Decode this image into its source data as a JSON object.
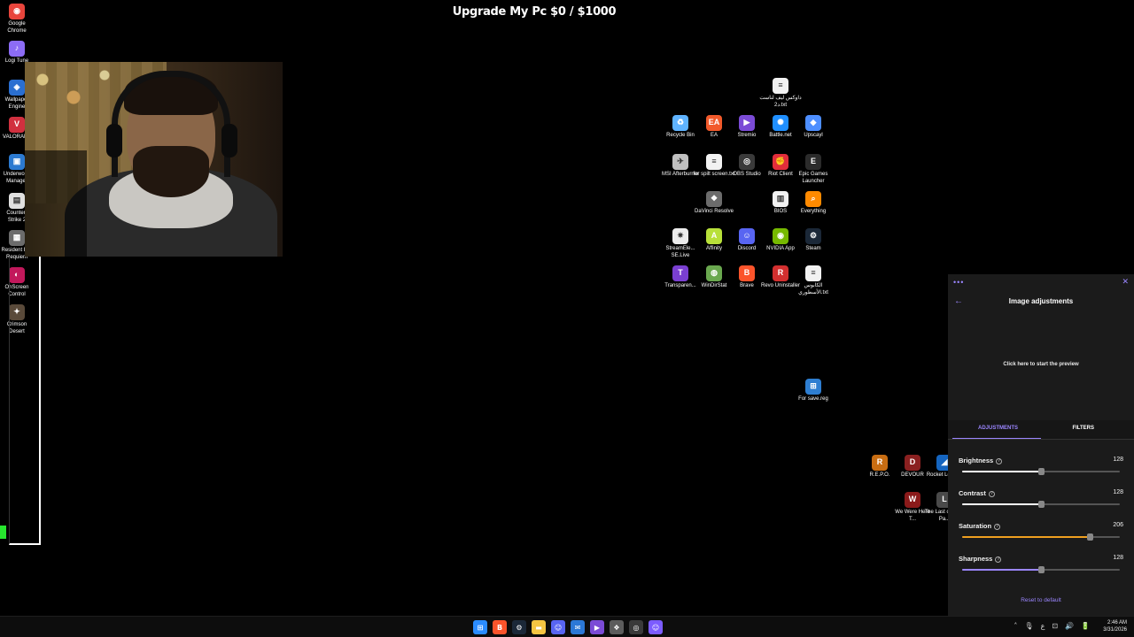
{
  "stream_title": "Upgrade My Pc $0 / $1000",
  "left_icons": [
    {
      "label": "Google Chrome",
      "icon": "chrome-icon",
      "color": "#e8453c",
      "glyph": "◉"
    },
    {
      "label": "Logi Tune",
      "icon": "logi-tune-icon",
      "color": "#8c6cf5",
      "glyph": "♪"
    },
    {
      "label": "Wallpaper Engine",
      "icon": "wallpaper-engine-icon",
      "color": "#2a6fd1",
      "glyph": "◈"
    },
    {
      "label": "VALORANT",
      "icon": "valorant-icon",
      "color": "#d1303f",
      "glyph": "V"
    },
    {
      "label": "Underworld Manager",
      "icon": "game-icon",
      "color": "#2c7ad0",
      "glyph": "▣"
    },
    {
      "label": "Counter-Strike 2",
      "icon": "cs2-icon",
      "color": "#e0e0e0",
      "glyph": "▤"
    },
    {
      "label": "Resident Evil Requiem",
      "icon": "resident-evil-icon",
      "color": "#6c6c6c",
      "glyph": "▦"
    },
    {
      "label": "OnScreen Control",
      "icon": "onscreen-control-icon",
      "color": "#c2185b",
      "glyph": "◐"
    },
    {
      "label": "Crimson Desert",
      "icon": "crimson-desert-icon",
      "color": "#5a4a3a",
      "glyph": "✦"
    }
  ],
  "desktop_icons": [
    {
      "label": "داوكس ليف لناست د2.txt",
      "icon": "text-file-icon",
      "color": "#f2f2f2",
      "glyph": "≡"
    },
    {
      "label": "Recycle Bin",
      "icon": "recycle-bin-icon",
      "color": "#5fb3ff",
      "glyph": "♻"
    },
    {
      "label": "EA",
      "icon": "ea-icon",
      "color": "#f25a2b",
      "glyph": "EA"
    },
    {
      "label": "Stremio",
      "icon": "stremio-icon",
      "color": "#7b4bd6",
      "glyph": "▶"
    },
    {
      "label": "Battle.net",
      "icon": "battlenet-icon",
      "color": "#1f8fff",
      "glyph": "✺"
    },
    {
      "label": "Upscayl",
      "icon": "upscayl-icon",
      "color": "#4d8eff",
      "glyph": "◆"
    },
    {
      "label": "MSI Afterburner",
      "icon": "msi-afterburner-icon",
      "color": "#c0c0c0",
      "glyph": "✈"
    },
    {
      "label": "for spilt screen.txt",
      "icon": "text-file-icon",
      "color": "#f2f2f2",
      "glyph": "≡"
    },
    {
      "label": "OBS Studio",
      "icon": "obs-icon",
      "color": "#3a3a3a",
      "glyph": "◎"
    },
    {
      "label": "Riot Client",
      "icon": "riot-client-icon",
      "color": "#e22d3b",
      "glyph": "✊"
    },
    {
      "label": "Epic Games Launcher",
      "icon": "epic-games-icon",
      "color": "#2b2b2b",
      "glyph": "E"
    },
    {
      "label": "DaVinci Resolve",
      "icon": "davinci-icon",
      "color": "#6c6c6c",
      "glyph": "❖"
    },
    {
      "label": "BIOS",
      "icon": "bios-icon",
      "color": "#f2f2f2",
      "glyph": "▥"
    },
    {
      "label": "Everything",
      "icon": "everything-icon",
      "color": "#ff8a00",
      "glyph": "⌕"
    },
    {
      "label": "StreamEle... SE.Live",
      "icon": "streamelements-icon",
      "color": "#ececec",
      "glyph": "✷"
    },
    {
      "label": "Affinity",
      "icon": "affinity-icon",
      "color": "#b8e03a",
      "glyph": "A"
    },
    {
      "label": "Discord",
      "icon": "discord-icon",
      "color": "#5865f2",
      "glyph": "☺"
    },
    {
      "label": "NVIDIA App",
      "icon": "nvidia-icon",
      "color": "#76b900",
      "glyph": "◉"
    },
    {
      "label": "Steam",
      "icon": "steam-icon",
      "color": "#1b2838",
      "glyph": "⚙"
    },
    {
      "label": "Transparen...",
      "icon": "transparent-icon",
      "color": "#7a3fd1",
      "glyph": "T"
    },
    {
      "label": "WinDirStat",
      "icon": "windirstat-icon",
      "color": "#6aa84f",
      "glyph": "◍"
    },
    {
      "label": "Brave",
      "icon": "brave-icon",
      "color": "#fb542b",
      "glyph": "B"
    },
    {
      "label": "Revo Uninstaller",
      "icon": "revo-icon",
      "color": "#d32f2f",
      "glyph": "R"
    },
    {
      "label": "الكابوس الأسطوري.txt",
      "icon": "text-file-icon",
      "color": "#f2f2f2",
      "glyph": "≡"
    },
    {
      "label": "For save.reg",
      "icon": "registry-icon",
      "color": "#2e7ed1",
      "glyph": "⊞"
    },
    {
      "label": "R.E.P.O.",
      "icon": "repo-icon",
      "color": "#c86d12",
      "glyph": "R"
    },
    {
      "label": "DEVOUR",
      "icon": "devour-icon",
      "color": "#8a2020",
      "glyph": "D"
    },
    {
      "label": "Rocket League",
      "icon": "rocket-league-icon",
      "color": "#1565c0",
      "glyph": "◢"
    },
    {
      "label": "We Were Here T...",
      "icon": "we-were-here-icon",
      "color": "#8b1a1a",
      "glyph": "W"
    },
    {
      "label": "The Last of Us™ Pa...",
      "icon": "tlou-icon",
      "color": "#4a4a4a",
      "glyph": "L"
    }
  ],
  "panel": {
    "menu": "•••",
    "close": "✕",
    "back": "←",
    "title": "Image adjustments",
    "preview_text": "Click here to start the preview",
    "tab_adjustments": "ADJUSTMENTS",
    "tab_filters": "FILTERS",
    "help_glyph": "?",
    "sliders": [
      {
        "name": "Brightness",
        "value": "128",
        "level": 0.502,
        "fill_color": "#ffffff"
      },
      {
        "name": "Contrast",
        "value": "128",
        "level": 0.502,
        "fill_color": "#ffffff"
      },
      {
        "name": "Saturation",
        "value": "206",
        "level": 0.808,
        "fill_color": "#f0a020"
      },
      {
        "name": "Sharpness",
        "value": "128",
        "level": 0.502,
        "fill_color": "#9b86ff"
      }
    ],
    "reset": "Reset to default",
    "accent": "#9b86ff"
  },
  "taskbar": {
    "apps": [
      {
        "name": "windows-start-icon",
        "color": "#2b8cff",
        "glyph": "⊞"
      },
      {
        "name": "brave-taskbar-icon",
        "color": "#fb542b",
        "glyph": "B"
      },
      {
        "name": "steam-taskbar-icon",
        "color": "#1b2838",
        "glyph": "⚙"
      },
      {
        "name": "file-explorer-icon",
        "color": "#f5c542",
        "glyph": "▬"
      },
      {
        "name": "discord-taskbar-icon",
        "color": "#5865f2",
        "glyph": "☺"
      },
      {
        "name": "mail-taskbar-icon",
        "color": "#2b78d6",
        "glyph": "✉"
      },
      {
        "name": "stremio-taskbar-icon",
        "color": "#7b4bd6",
        "glyph": "▶"
      },
      {
        "name": "davinci-taskbar-icon",
        "color": "#5c5c5c",
        "glyph": "❖"
      },
      {
        "name": "obs-taskbar-icon",
        "color": "#3a3a3a",
        "glyph": "◎"
      },
      {
        "name": "discord-ptb-taskbar-icon",
        "color": "#7c5cff",
        "glyph": "☺"
      }
    ],
    "tray": [
      "˄",
      "🎙",
      "ع",
      "⊡",
      "🔊",
      "🔋"
    ],
    "time": "2:46 AM",
    "date": "3/31/2026"
  }
}
